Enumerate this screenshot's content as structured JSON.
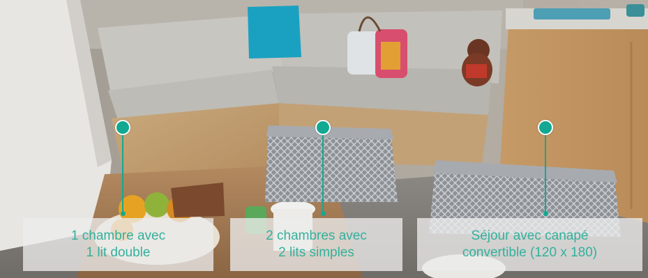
{
  "features": [
    {
      "line1": "1 chambre avec",
      "line2": "1 lit double"
    },
    {
      "line1": "2 chambres avec",
      "line2": "2 lits simples"
    },
    {
      "line1": "Séjour avec canapé",
      "line2": "convertible (120 x 180)"
    }
  ],
  "colors": {
    "accent": "#13a892",
    "label_text": "#33b09c",
    "label_background": "#ececec"
  },
  "icons": [
    "hotspot-dot-icon"
  ]
}
